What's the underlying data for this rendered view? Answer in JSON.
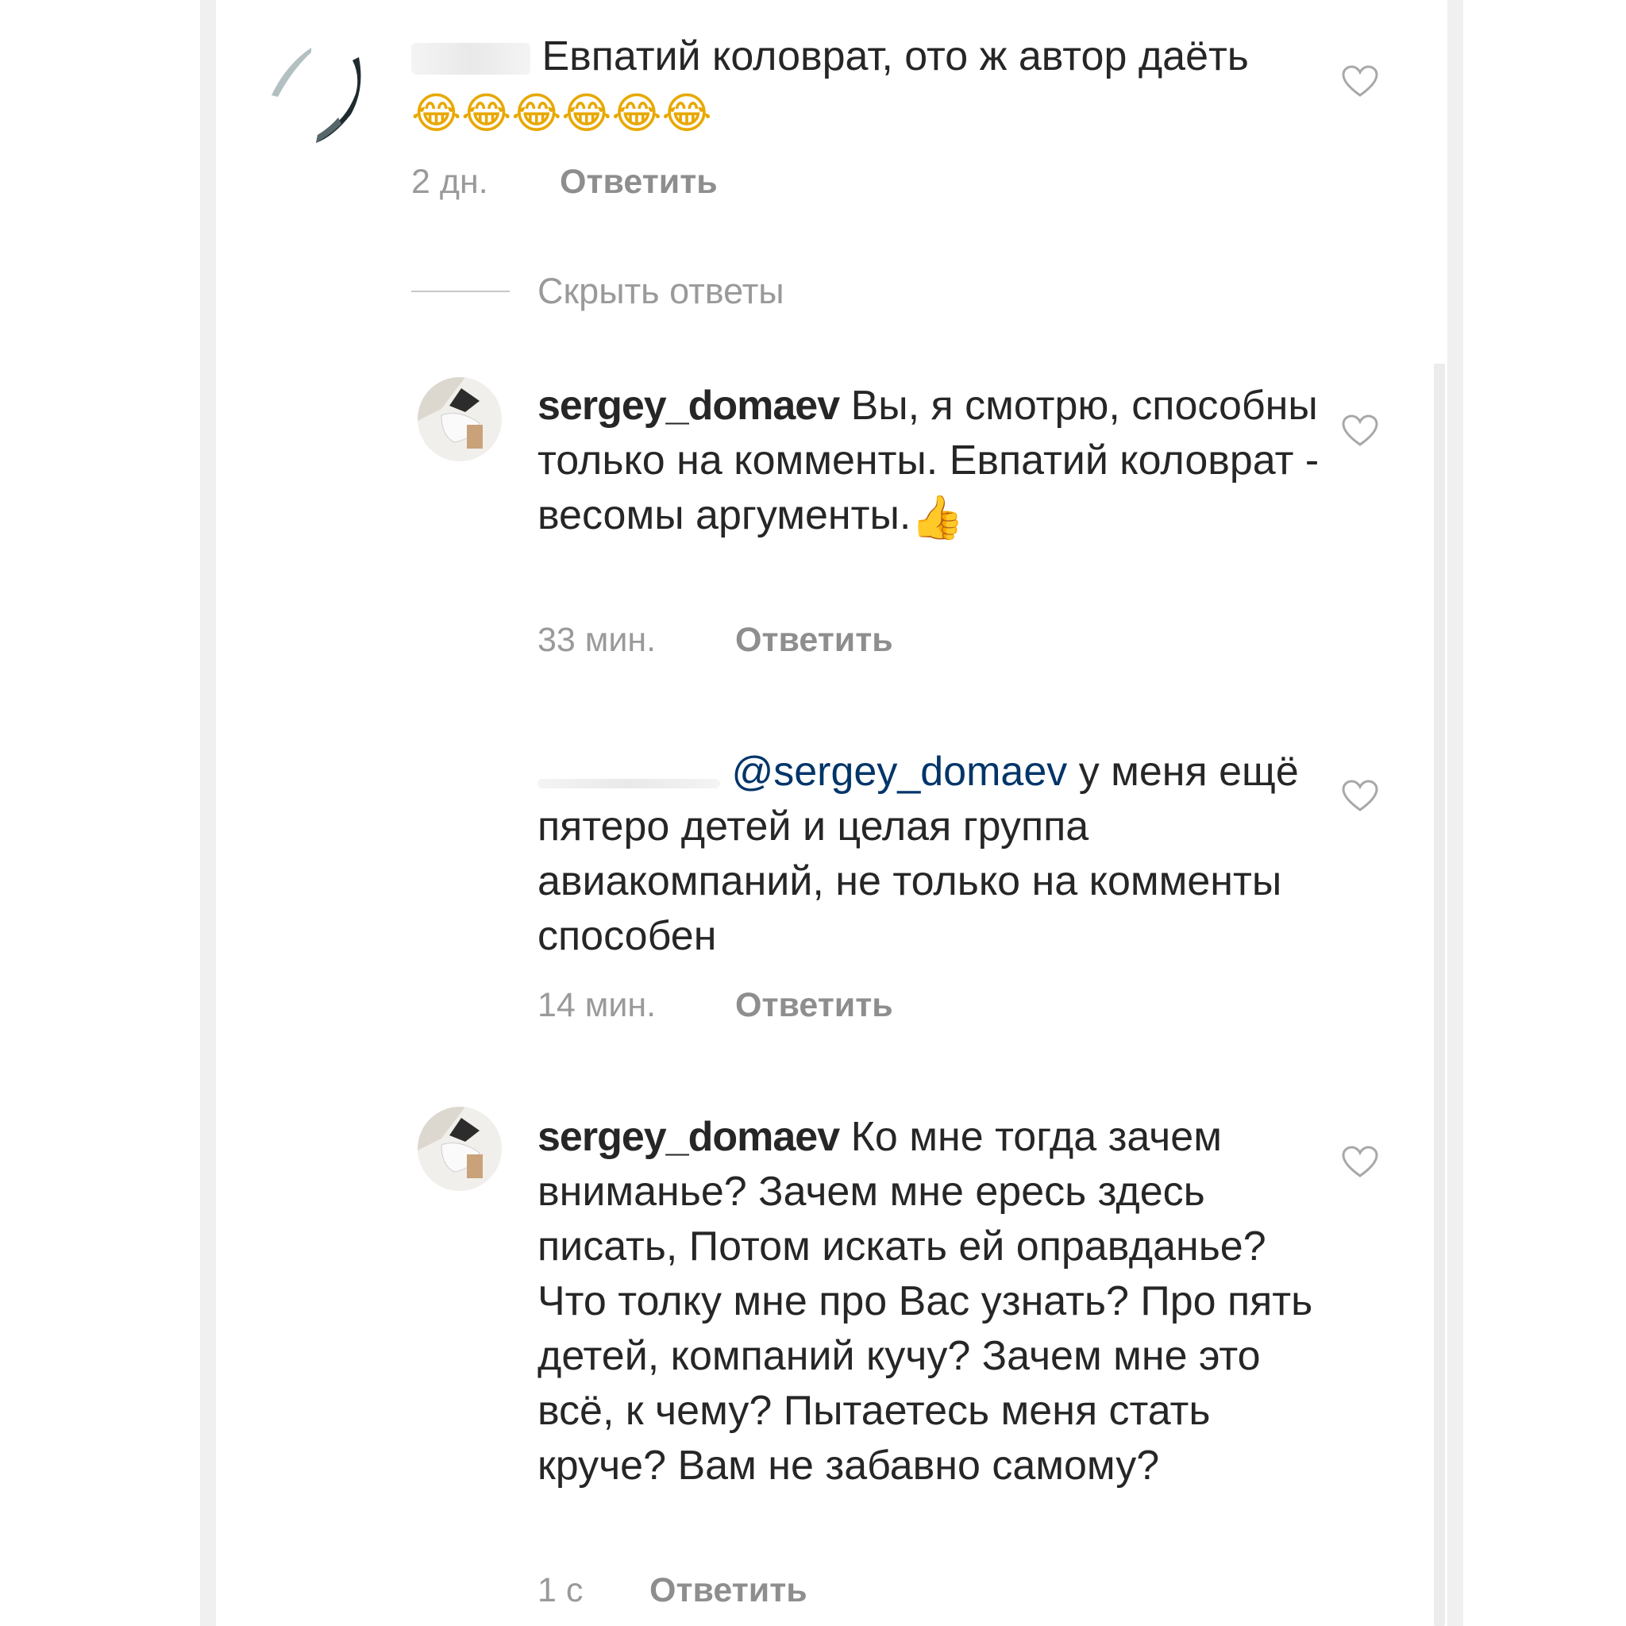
{
  "hide_replies_label": "Скрыть ответы",
  "reply_label": "Ответить",
  "accent_colors": {
    "mention": "#003569",
    "text": "#262626",
    "meta": "#9a9a9a"
  },
  "comments": [
    {
      "username": "",
      "text": "Евпатий коловрат, ото ж автор даёть",
      "emoji": "😂😂😂😂😂😂",
      "time": "2 дн.",
      "liked": false
    },
    {
      "username": "sergey_domaev",
      "text": "Вы, я смотрю, способны только на комменты. Евпатий коловрат - весомы аргументы.",
      "emoji": "👍",
      "time": "33 мин.",
      "liked": false
    },
    {
      "username": "",
      "mention": "@sergey_domaev",
      "text": "у меня ещё пятеро детей и целая группа авиакомпаний, не только на комменты способен",
      "time": "14 мин.",
      "liked": false
    },
    {
      "username": "sergey_domaev",
      "text": "Ко мне тогда зачем вниманье? Зачем мне ересь здесь писать, Потом искать ей оправданье? Что толку мне про Вас узнать? Про пять детей, компаний кучу? Зачем мне это всё, к чему? Пытаетесь меня стать круче? Вам не забавно самому?",
      "time": "1 с",
      "liked": false
    }
  ]
}
